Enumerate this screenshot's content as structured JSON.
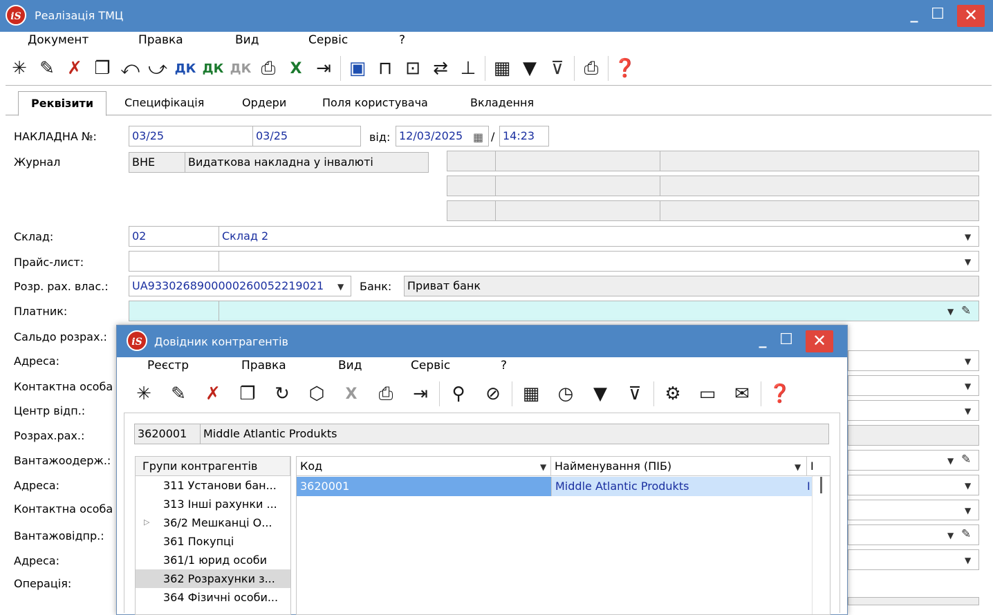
{
  "window": {
    "title": "Реалізація ТМЦ",
    "logo": "iS"
  },
  "menu": [
    "Документ",
    "Правка",
    "Вид",
    "Сервіс",
    "?"
  ],
  "toolbar_icons": [
    "new-doc-icon",
    "edit-doc-icon",
    "delete-doc-icon",
    "copy-doc-icon",
    "import-icon",
    "export-icon",
    "debit-credit-icon",
    "debit-credit-2-icon",
    "debit-credit-3-icon",
    "print-preview-icon",
    "excel-icon",
    "exit-icon",
    "save-icon",
    "book-icon",
    "folder-icon",
    "link-icon",
    "tree-icon",
    "grid-icon",
    "filter-icon",
    "clear-filter-icon",
    "printer-icon",
    "help-icon"
  ],
  "tabs": [
    "Реквізити",
    "Специфікація",
    "Ордери",
    "Поля користувача",
    "Вкладення"
  ],
  "form": {
    "invoice_label": "НАКЛАДНА №:",
    "invoice_no_1": "03/25",
    "invoice_no_2": "03/25",
    "from_label": "від:",
    "date": "12/03/2025",
    "slash": "/",
    "time": "14:23",
    "journal_label": "Журнал",
    "journal_code": "ВНЕ",
    "journal_name": "Видаткова накладна у інвалюті",
    "warehouse_label": "Склад:",
    "warehouse_code": "02",
    "warehouse_name": "Склад 2",
    "pricelist_label": "Прайс-лист:",
    "account_label": "Розр. рах. влас.:",
    "account_value": "UA9330268900000260052219021",
    "bank_label": "Банк:",
    "bank_value": "Приват банк",
    "payer_label": "Платник:",
    "balance_label": "Сальдо розрах.:",
    "address_label_1": "Адреса:",
    "contact_label_1": "Контактна особа",
    "center_label": "Центр відп.:",
    "calc_account_label": "Розрах.рах.:",
    "consignee_label": "Вантажоодерж.:",
    "address_label_2": "Адреса:",
    "contact_label_2": "Контактна особа",
    "shipper_label": "Вантажовідпр.:",
    "address_label_3": "Адреса:",
    "operation_label": "Операція:"
  },
  "dialog": {
    "title": "Довідник контрагентів",
    "menu": [
      "Реєстр",
      "Правка",
      "Вид",
      "Сервіс",
      "?"
    ],
    "search_code": "3620001",
    "search_name": "Middle Atlantic Produkts",
    "tree_header": "Групи контрагентів",
    "tree_items": [
      "311 Установи бан...",
      "313 Інші рахунки ...",
      "36/2 Мешканці О...",
      "361 Покупці",
      "361/1 юрид особи",
      "362 Розрахунки з...",
      "364 Фізичні особи..."
    ],
    "grid_headers": [
      "Код",
      "Найменування (ПІБ)",
      "І"
    ],
    "rows": [
      {
        "code": "3620001",
        "name": "Middle Atlantic Produkts",
        "extra": "І"
      }
    ]
  },
  "colors": {
    "titlebar": "#4d86c4",
    "close": "#e0463c",
    "selected_row": "#6ea8ea",
    "payer_field": "#d5f7f6"
  }
}
